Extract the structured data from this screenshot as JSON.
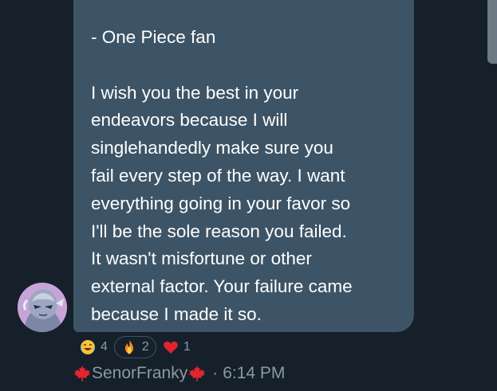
{
  "message": {
    "lines": [
      "- One Piece fan",
      "",
      "I wish you the best in your",
      "endeavors because I will",
      "singlehandedly make sure you",
      "fail every step of the way. I want",
      "everything going in your favor so",
      "I'll be the sole reason you failed.",
      "It wasn't misfortune or other",
      "external factor. Your failure came",
      "because I made it so."
    ]
  },
  "reactions": [
    {
      "icon": "laughing-crying-emoji-icon",
      "count": "4"
    },
    {
      "icon": "fire-emoji-icon",
      "count": "2"
    },
    {
      "icon": "red-heart-emoji-icon",
      "count": "1"
    }
  ],
  "sender": {
    "name": "SenorFranky",
    "separator": "·",
    "time": "6:14 PM",
    "flag_icon": "maple-leaf-icon"
  },
  "colors": {
    "background": "#15202b",
    "bubble": "#3d5466",
    "meta_text": "#8b98a5"
  }
}
